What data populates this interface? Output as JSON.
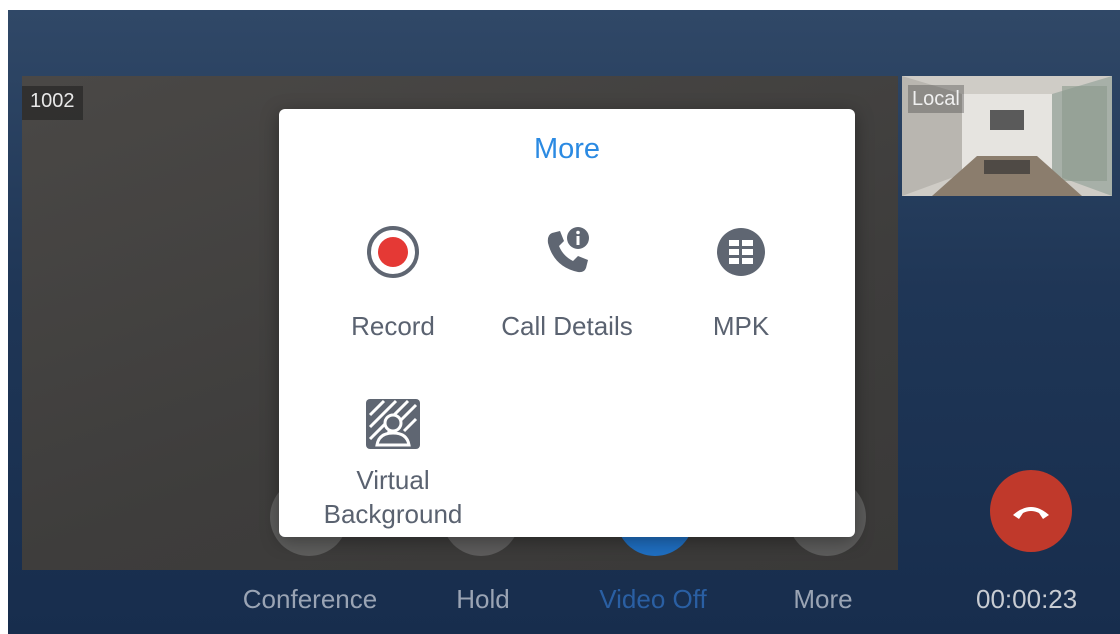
{
  "remote": {
    "label": "1002"
  },
  "local": {
    "label": "Local"
  },
  "controls": [
    {
      "label": "Conference"
    },
    {
      "label": "Hold"
    },
    {
      "label": "Video Off"
    },
    {
      "label": "More"
    }
  ],
  "timer": "00:00:23",
  "dialog": {
    "title": "More",
    "options": [
      {
        "label": "Record",
        "icon": "record-icon"
      },
      {
        "label": "Call Details",
        "icon": "call-details-icon"
      },
      {
        "label": "MPK",
        "icon": "mpk-icon"
      },
      {
        "label": "Virtual Background",
        "icon": "virtual-background-icon"
      }
    ]
  },
  "colors": {
    "accent": "#2b8ae2",
    "record_red": "#e53935",
    "end_call_red": "#c0392b",
    "icon_gray": "#5f6672"
  }
}
